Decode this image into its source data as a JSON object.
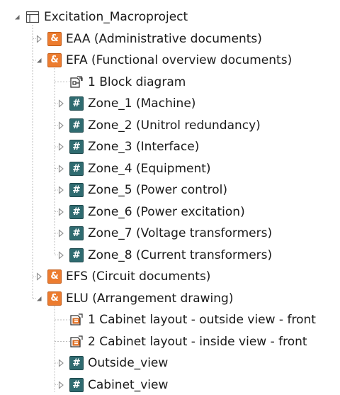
{
  "tree": {
    "nodes": [
      {
        "label": "Excitation_Macroproject",
        "icon": "project-icon",
        "expander": "expanded"
      },
      {
        "label": "EAA (Administrative documents)",
        "icon": "ampersand-icon",
        "expander": "collapsed"
      },
      {
        "label": "EFA (Functional overview documents)",
        "icon": "ampersand-icon",
        "expander": "expanded"
      },
      {
        "label": "1 Block diagram",
        "icon": "block-diagram-icon",
        "expander": "none"
      },
      {
        "label": "Zone_1 (Machine)",
        "icon": "hash-icon",
        "expander": "collapsed"
      },
      {
        "label": "Zone_2 (Unitrol redundancy)",
        "icon": "hash-icon",
        "expander": "collapsed"
      },
      {
        "label": "Zone_3 (Interface)",
        "icon": "hash-icon",
        "expander": "collapsed"
      },
      {
        "label": "Zone_4 (Equipment)",
        "icon": "hash-icon",
        "expander": "collapsed"
      },
      {
        "label": "Zone_5 (Power control)",
        "icon": "hash-icon",
        "expander": "collapsed"
      },
      {
        "label": "Zone_6 (Power excitation)",
        "icon": "hash-icon",
        "expander": "collapsed"
      },
      {
        "label": "Zone_7 (Voltage transformers)",
        "icon": "hash-icon",
        "expander": "collapsed"
      },
      {
        "label": "Zone_8 (Current transformers)",
        "icon": "hash-icon",
        "expander": "collapsed"
      },
      {
        "label": "EFS (Circuit documents)",
        "icon": "ampersand-icon",
        "expander": "collapsed"
      },
      {
        "label": "ELU (Arrangement drawing)",
        "icon": "ampersand-icon",
        "expander": "expanded"
      },
      {
        "label": "1 Cabinet layout - outside view - front",
        "icon": "cabinet-layout-icon",
        "expander": "none"
      },
      {
        "label": "2 Cabinet layout - inside view - front",
        "icon": "cabinet-layout-icon",
        "expander": "none"
      },
      {
        "label": "Outside_view",
        "icon": "hash-icon",
        "expander": "collapsed"
      },
      {
        "label": "Cabinet_view",
        "icon": "hash-icon",
        "expander": "collapsed"
      }
    ],
    "ampersand_glyph": "&",
    "hash_glyph": "#"
  },
  "colors": {
    "orange_icon": "#ec7c2f",
    "teal_icon": "#2f6b70",
    "guide_line": "#bdbdbd",
    "expander": "#8a8a8a"
  }
}
